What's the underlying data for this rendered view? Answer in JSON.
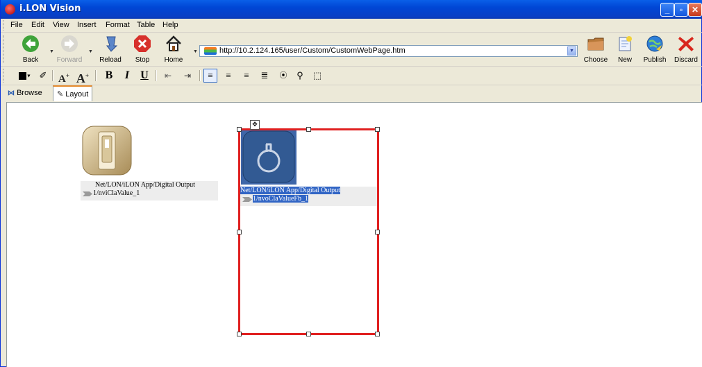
{
  "window": {
    "title": "i.LON Vision",
    "min_label": "_",
    "max_label": "▫",
    "close_label": "✕"
  },
  "menu": [
    "File",
    "Edit",
    "View",
    "Insert",
    "Format",
    "Table",
    "Help"
  ],
  "toolbar": {
    "back": "Back",
    "forward": "Forward",
    "reload": "Reload",
    "stop": "Stop",
    "home": "Home",
    "url": "http://10.2.124.165/user/Custom/CustomWebPage.htm",
    "choose": "Choose",
    "new": "New",
    "publish": "Publish",
    "discard": "Discard"
  },
  "formatbar": {
    "bold": "B",
    "italic": "I",
    "underline": "U",
    "a_grow": "A",
    "a_shrink": "A"
  },
  "tabs": {
    "browse": "Browse",
    "layout": "Layout"
  },
  "widgets": [
    {
      "line1": "Net/LON/iLON App/Digital Output",
      "line2": "1/nviClaValue_1"
    },
    {
      "line1": "Net/LON/iLON App/Digital Output",
      "line2": "1/nvoClaValueFb_1"
    }
  ],
  "colors": {
    "title_bar": "#0054e3",
    "selection_border": "#e02020",
    "selection_text": "#3165c5"
  }
}
